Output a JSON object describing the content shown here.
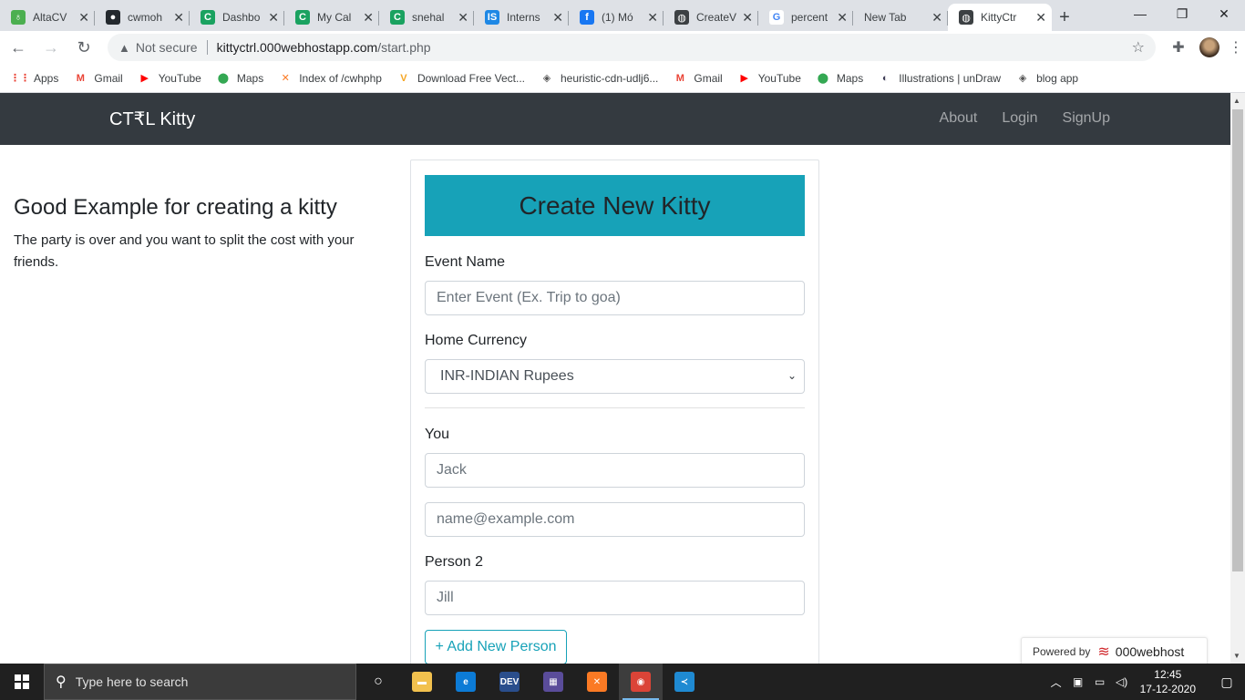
{
  "browser": {
    "tabs": [
      {
        "title": "AltaCV",
        "fav_color": "#4caf50",
        "fav_glyph": "♁"
      },
      {
        "title": "cwmoh",
        "fav_color": "#24292e",
        "fav_glyph": "●"
      },
      {
        "title": "Dashbo",
        "fav_color": "#1aa260",
        "fav_glyph": "C"
      },
      {
        "title": "My Cal",
        "fav_color": "#1aa260",
        "fav_glyph": "C"
      },
      {
        "title": "snehal",
        "fav_color": "#1aa260",
        "fav_glyph": "C"
      },
      {
        "title": "Interns",
        "fav_color": "#1e88e5",
        "fav_glyph": "IS"
      },
      {
        "title": "(1) Mó",
        "fav_color": "#1877f2",
        "fav_glyph": "f"
      },
      {
        "title": "CreateV",
        "fav_color": "#3c4043",
        "fav_glyph": "◍"
      },
      {
        "title": "percent",
        "fav_color": "#ffffff",
        "fav_glyph": "G"
      },
      {
        "title": "New Tab",
        "fav_color": "",
        "fav_glyph": ""
      },
      {
        "title": "KittyCtr",
        "fav_color": "#3c4043",
        "fav_glyph": "◍",
        "active": true
      }
    ],
    "new_tab_glyph": "+",
    "window_controls": {
      "minimize": "—",
      "restore": "❐",
      "close": "✕"
    },
    "address": {
      "security_label": "Not secure",
      "domain": "kittyctrl.000webhostapp.com",
      "path": "/start.php"
    },
    "bookmarks": [
      {
        "label": "Apps",
        "icon": "apps-grid-icon",
        "color": "#ea4335",
        "glyph": "⋮⋮"
      },
      {
        "label": "Gmail",
        "icon": "gmail-icon",
        "color": "#ea4335",
        "glyph": "M"
      },
      {
        "label": "YouTube",
        "icon": "youtube-icon",
        "color": "#ff0000",
        "glyph": "▶"
      },
      {
        "label": "Maps",
        "icon": "maps-icon",
        "color": "#34a853",
        "glyph": "⬤"
      },
      {
        "label": "Index of /cwhphp",
        "icon": "xampp-icon",
        "color": "#fb7a24",
        "glyph": "✕"
      },
      {
        "label": "Download Free Vect...",
        "icon": "vecteezy-icon",
        "color": "#f5a623",
        "glyph": "V"
      },
      {
        "label": "heuristic-cdn-udlj6...",
        "icon": "codesandbox-icon",
        "color": "#555555",
        "glyph": "◈"
      },
      {
        "label": "Gmail",
        "icon": "gmail-icon",
        "color": "#ea4335",
        "glyph": "M"
      },
      {
        "label": "YouTube",
        "icon": "youtube-icon",
        "color": "#ff0000",
        "glyph": "▶"
      },
      {
        "label": "Maps",
        "icon": "maps-icon",
        "color": "#34a853",
        "glyph": "⬤"
      },
      {
        "label": "Illustrations | unDraw",
        "icon": "undraw-icon",
        "color": "#3f3d56",
        "glyph": "◐"
      },
      {
        "label": "blog app",
        "icon": "codesandbox-icon",
        "color": "#555555",
        "glyph": "◈"
      }
    ]
  },
  "site": {
    "brand": "CT₹L Kitty",
    "nav": [
      "About",
      "Login",
      "SignUp"
    ],
    "example_heading": "Good Example for creating a kitty",
    "example_text": "The party is over and you want to split the cost with your friends.",
    "form": {
      "header": "Create New Kitty",
      "event_label": "Event Name",
      "event_placeholder": "Enter Event (Ex. Trip to goa)",
      "currency_label": "Home Currency",
      "currency_selected": "INR-INDIAN Rupees",
      "you_label": "You",
      "you_name_placeholder": "Jack",
      "you_email_placeholder": "name@example.com",
      "person2_label": "Person 2",
      "person2_placeholder": "Jill",
      "add_person": "+ Add New Person"
    },
    "powered_by": "Powered by",
    "powered_brand": "000webhost",
    "accent_color": "#17a2b8",
    "navbar_color": "#343a40"
  },
  "taskbar": {
    "search_placeholder": "Type here to search",
    "apps": [
      {
        "name": "task-view",
        "glyph": "○",
        "color": ""
      },
      {
        "name": "file-explorer",
        "glyph": "▬",
        "color": "#f2c14e"
      },
      {
        "name": "edge",
        "glyph": "e",
        "color": "#0c7bd6"
      },
      {
        "name": "dev-c",
        "glyph": "DEV",
        "color": "#2a4e8c"
      },
      {
        "name": "db-app",
        "glyph": "▦",
        "color": "#5a4c9a"
      },
      {
        "name": "xampp",
        "glyph": "✕",
        "color": "#fb7a24"
      },
      {
        "name": "chrome",
        "glyph": "◉",
        "color": "#db4437",
        "active": true
      },
      {
        "name": "vscode",
        "glyph": "≺",
        "color": "#1f8ad2"
      }
    ],
    "time": "12:45",
    "date": "17-12-2020"
  }
}
